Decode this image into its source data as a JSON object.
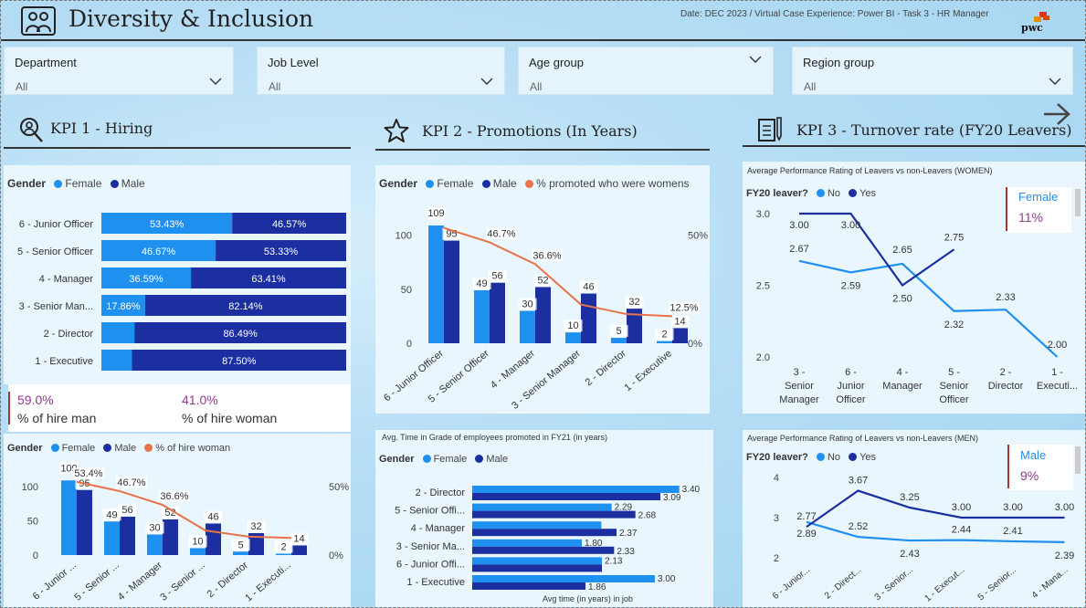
{
  "header": {
    "title": "Diversity & Inclusion",
    "meta": "Date: DEC 2023 / Virtual Case Experience: Power BI - Task 3 - HR Manager",
    "logo": "pwc"
  },
  "filters": [
    {
      "label": "Department",
      "value": "All"
    },
    {
      "label": "Job Level",
      "value": "All"
    },
    {
      "label": "Age group",
      "value": "All"
    },
    {
      "label": "Region group",
      "value": "All"
    }
  ],
  "kpis": {
    "hiring": "KPI 1 - Hiring",
    "promotions": "KPI 2 - Promotions (In Years)",
    "turnover": "KPI 3 - Turnover rate (FY20 Leavers)"
  },
  "legend": {
    "gender": "Gender",
    "female": "Female",
    "male": "Male",
    "promoted_women": "% promoted who were womens",
    "hire_woman": "% of hire woman",
    "fy20": "FY20 leaver?",
    "no": "No",
    "yes": "Yes"
  },
  "colors": {
    "female": "#1e90f0",
    "male": "#1b2fa0",
    "line": "#e8734a",
    "accent_text": "#8e3c8e"
  },
  "cards": {
    "hire_man": {
      "value": "59.0%",
      "label": "% of hire man"
    },
    "hire_woman": {
      "value": "41.0%",
      "label": "% of hire woman"
    },
    "female_turnover": {
      "label": "Female",
      "value": "11%"
    },
    "male_turnover": {
      "label": "Male",
      "value": "9%"
    }
  },
  "titles": {
    "avg_time": "Avg. Time in Grade of employees promoted in FY21 (in years)",
    "avg_time_x": "Avg time (in years) in job",
    "women_perf": "Average Performance Rating of Leavers vs non-Leavers (WOMEN)",
    "men_perf": "Average Performance Rating of Leavers vs non-Leavers (MEN)"
  },
  "chart_data": [
    {
      "type": "bar",
      "name": "hiring-stacked",
      "categories": [
        "6 - Junior Officer",
        "5 - Senior Officer",
        "4 - Manager",
        "3 - Senior Man...",
        "2 - Director",
        "1 - Executive"
      ],
      "series": [
        {
          "name": "Female",
          "values": [
            53.43,
            46.67,
            36.59,
            17.86,
            13.51,
            12.5
          ],
          "labels": [
            "53.43%",
            "46.67%",
            "36.59%",
            "17.86%",
            "",
            ""
          ]
        },
        {
          "name": "Male",
          "values": [
            46.57,
            53.33,
            63.41,
            82.14,
            86.49,
            87.5
          ],
          "labels": [
            "46.57%",
            "53.33%",
            "63.41%",
            "82.14%",
            "86.49%",
            "87.50%"
          ]
        }
      ]
    },
    {
      "type": "bar",
      "name": "promotions-combo",
      "categories": [
        "6 - Junior Officer",
        "5 - Senior Officer",
        "4 - Manager",
        "3 - Senior Manager",
        "2 - Director",
        "1 - Executive"
      ],
      "series": [
        {
          "name": "Female",
          "values": [
            109,
            49,
            30,
            10,
            5,
            2
          ]
        },
        {
          "name": "Male",
          "values": [
            95,
            56,
            52,
            46,
            32,
            14
          ]
        },
        {
          "name": "% promoted who were womens",
          "values": [
            53.4,
            46.7,
            36.6,
            17.9,
            13.5,
            12.5
          ],
          "labels": [
            "",
            "46.7%",
            "36.6%",
            "",
            "",
            "12.5%"
          ]
        }
      ],
      "y_ticks": [
        "0",
        "50",
        "100"
      ],
      "y2_ticks": [
        "0%",
        "50%"
      ]
    },
    {
      "type": "bar",
      "name": "hiring-combo",
      "categories": [
        "6 - Junior ...",
        "5 - Senior ...",
        "4 - Manager",
        "3 - Senior ...",
        "2 - Director",
        "1 - Executi..."
      ],
      "series": [
        {
          "name": "Female",
          "values": [
            109,
            49,
            30,
            10,
            5,
            2
          ]
        },
        {
          "name": "Male",
          "values": [
            95,
            56,
            52,
            46,
            32,
            14
          ]
        },
        {
          "name": "% of hire woman",
          "values": [
            53.4,
            46.7,
            36.6,
            17.9,
            13.5,
            12.5
          ],
          "labels": [
            "53.4%",
            "46.7%",
            "36.6%",
            "",
            "",
            ""
          ]
        }
      ],
      "y_ticks": [
        "0",
        "50",
        "100"
      ],
      "y2_ticks": [
        "0%",
        "50%"
      ]
    },
    {
      "type": "bar",
      "name": "avg-time-in-grade",
      "categories": [
        "2 - Director",
        "5 - Senior Offi...",
        "4 - Manager",
        "3 - Senior Ma...",
        "6 - Junior Offi...",
        "1 - Executive"
      ],
      "series": [
        {
          "name": "Female",
          "values": [
            3.4,
            2.29,
            2.12,
            1.8,
            2.13,
            3.0
          ]
        },
        {
          "name": "Male",
          "values": [
            3.09,
            2.68,
            2.37,
            2.33,
            2.13,
            1.86
          ]
        }
      ],
      "labels": [
        [
          "3.40",
          "3.09"
        ],
        [
          "2.29",
          "2.68"
        ],
        [
          "",
          "2.37"
        ],
        [
          "1.80",
          "2.33"
        ],
        [
          "2.13",
          ""
        ],
        [
          "3.00",
          "1.86"
        ]
      ],
      "xlabel": "Avg time (in years) in job"
    },
    {
      "type": "line",
      "name": "women-performance",
      "categories": [
        "3 - Senior Manager",
        "6 - Junior Officer",
        "4 - Manager",
        "5 - Senior Officer",
        "2 - Director",
        "1 - Executi..."
      ],
      "tick_labels": [
        [
          "3 -",
          "Senior",
          "Manager"
        ],
        [
          "6 -",
          "Junior",
          "Officer"
        ],
        [
          "4 -",
          "Manager"
        ],
        [
          "5 -",
          "Senior",
          "Officer"
        ],
        [
          "2 -",
          "Director"
        ],
        [
          "1 -",
          "Executi..."
        ]
      ],
      "series": [
        {
          "name": "No",
          "values": [
            2.67,
            2.59,
            2.65,
            2.32,
            2.33,
            2.0
          ]
        },
        {
          "name": "Yes",
          "values": [
            3.0,
            3.0,
            2.5,
            2.75
          ]
        }
      ],
      "labels": {
        "No": [
          "2.67",
          "2.59",
          "2.65",
          "2.32",
          "2.33",
          "2.00"
        ],
        "Yes": [
          "3.00",
          "3.00",
          "2.50",
          "2.75"
        ]
      },
      "y_ticks": [
        "2.0",
        "2.5",
        "3.0"
      ],
      "ylim": [
        2.0,
        3.0
      ]
    },
    {
      "type": "line",
      "name": "men-performance",
      "categories": [
        "6 - Junior...",
        "2 - Direct...",
        "3 - Senior...",
        "1 - Execut...",
        "5 - Senior...",
        "4 - Mana..."
      ],
      "series": [
        {
          "name": "No",
          "values": [
            2.89,
            2.52,
            2.43,
            2.44,
            2.41,
            2.39
          ]
        },
        {
          "name": "Yes",
          "values": [
            2.77,
            3.67,
            3.25,
            3.0,
            3.0,
            3.0
          ]
        }
      ],
      "labels": {
        "No": [
          "2.89",
          "2.52",
          "2.43",
          "2.44",
          "2.41",
          "2.39"
        ],
        "Yes": [
          "2.77",
          "3.67",
          "3.25",
          "3.00",
          "3.00",
          "3.00"
        ]
      },
      "y_ticks": [
        "2",
        "3",
        "4"
      ],
      "ylim": [
        2,
        4
      ]
    }
  ]
}
